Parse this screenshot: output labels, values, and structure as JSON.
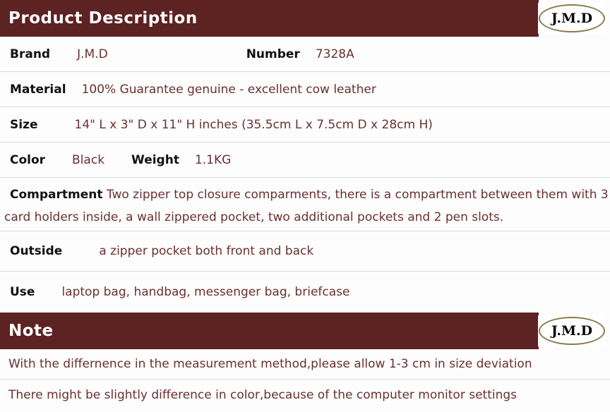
{
  "brand_logo": {
    "text": "J.M.D",
    "shape": "ellipse-outline",
    "border_color": "#8a7a4e",
    "text_color": "#0a0a0a"
  },
  "colors": {
    "header_bar": "#5d2222",
    "header_text": "#ffffff",
    "label_text": "#111111",
    "value_text": "#6b3030",
    "row_divider": "#dcdcdc",
    "page_background": "#fdfdfd"
  },
  "product_section": {
    "title": "Product Description",
    "rows": [
      {
        "label": "Brand",
        "value": "J.M.D",
        "label2": "Number",
        "value2": "7328A"
      },
      {
        "label": "Material",
        "value": "100% Guarantee genuine - excellent cow leather"
      },
      {
        "label": "Size",
        "value": "14\" L x 3\" D x 11\" H inches (35.5cm L x 7.5cm D x 28cm H)"
      },
      {
        "label": "Color",
        "value": "Black",
        "label2": "Weight",
        "value2": "1.1KG"
      },
      {
        "label": "Compartment",
        "value": "Two zipper top closure comparments, there is a compartment between them with 3 card holders inside, a wall zippered pocket, two additional pockets and 2 pen slots."
      },
      {
        "label": "Outside",
        "value": "a zipper pocket both front and back"
      },
      {
        "label": "Use",
        "value": "laptop bag, handbag, messenger bag, briefcase"
      }
    ]
  },
  "note_section": {
    "title": "Note",
    "lines": [
      "With the differnence in the measurement method,please allow 1-3 cm in size deviation",
      "There might be slightly difference in color,because of the computer monitor settings"
    ]
  }
}
